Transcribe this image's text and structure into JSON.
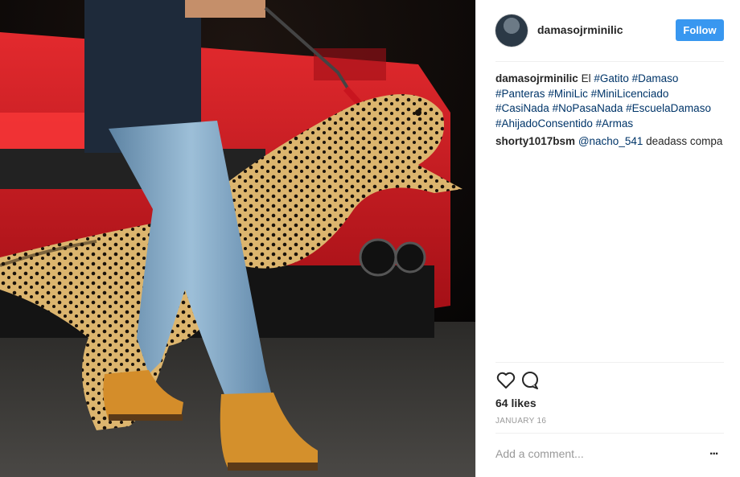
{
  "post": {
    "username": "damasojrminilic",
    "follow_label": "Follow",
    "caption": {
      "username": "damasojrminilic",
      "text": "El",
      "hashtags": [
        "#Gatito",
        "#Damaso",
        "#Panteras",
        "#MiniLic",
        "#MiniLicenciado",
        "#CasiNada",
        "#NoPasaNada",
        "#EscuelaDamaso",
        "#AhijadoConsentido",
        "#Armas"
      ]
    },
    "comment": {
      "username": "shorty1017bsm",
      "mention": "@nacho_541",
      "text": "deadass compa"
    },
    "likes": "64 likes",
    "date": "JANUARY 16",
    "add_comment_placeholder": "Add a comment...",
    "more_label": "..."
  },
  "photo": {
    "subject": "man in jeans and tan boots walking a cheetah on a red leash in front of a red sports car",
    "colors": {
      "car": "#c4131b",
      "cheetah": "#d9b26a",
      "jeans": "#7fa4c2",
      "boots": "#d4902c",
      "ground": "#3a3a38"
    }
  },
  "icons": [
    "heart-icon",
    "comment-icon",
    "more-options-icon"
  ]
}
